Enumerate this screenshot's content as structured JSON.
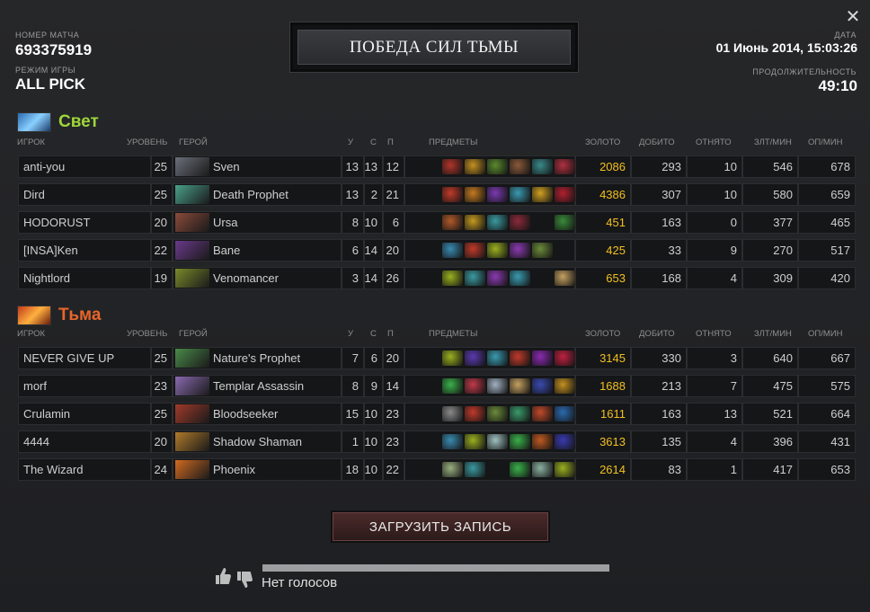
{
  "match": {
    "id_label": "НОМЕР МАТЧА",
    "id": "693375919",
    "mode_label": "РЕЖИМ ИГРЫ",
    "mode": "ALL PICK",
    "result": "ПОБЕДА СИЛ ТЬМЫ",
    "date_label": "ДАТА",
    "date": "01 Июнь 2014, 15:03:26",
    "duration_label": "ПРОДОЛЖИТЕЛЬНОСТЬ",
    "duration": "49:10"
  },
  "columns": {
    "player": "ИГРОК",
    "level": "УРОВЕНЬ",
    "hero": "ГЕРОЙ",
    "kills": "У",
    "deaths": "С",
    "assists": "П",
    "items": "ПРЕДМЕТЫ",
    "gold": "ЗОЛОТО",
    "last_hits": "ДОБИТО",
    "denies": "ОТНЯТО",
    "gpm": "ЗЛТ/МИН",
    "xpm": "ОП/МИН"
  },
  "teams": [
    {
      "name": "Свет",
      "color": "#9fd63a",
      "players": [
        {
          "player": "anti-you",
          "level": "25",
          "hero": "Sven",
          "k": "13",
          "d": "13",
          "a": "12",
          "gold": "2086",
          "lh": "293",
          "dn": "10",
          "gpm": "546",
          "xpm": "678",
          "hero_color": "#6b6f7a",
          "items": [
            "#b0352b",
            "#c49020",
            "#5a8a2e",
            "#8a5a3a",
            "#3a8a8a",
            "#b03040"
          ]
        },
        {
          "player": "Dird",
          "level": "25",
          "hero": "Death Prophet",
          "k": "13",
          "d": "2",
          "a": "21",
          "gold": "4386",
          "lh": "307",
          "dn": "10",
          "gpm": "580",
          "xpm": "659",
          "hero_color": "#4aa08a",
          "items": [
            "#c03a2a",
            "#c47a20",
            "#7a3ab0",
            "#3a9ab0",
            "#d0a020",
            "#b02030"
          ]
        },
        {
          "player": "HODORUST",
          "level": "20",
          "hero": "Ursa",
          "k": "8",
          "d": "10",
          "a": "6",
          "gold": "451",
          "lh": "163",
          "dn": "0",
          "gpm": "377",
          "xpm": "465",
          "hero_color": "#8a4a3a",
          "items": [
            "#b05a2a",
            "#c49a20",
            "#3a9aa0",
            "#8a2a3a",
            "",
            "#3a8a3a"
          ]
        },
        {
          "player": "[INSA]Ken",
          "level": "22",
          "hero": "Bane",
          "k": "6",
          "d": "14",
          "a": "20",
          "gold": "425",
          "lh": "33",
          "dn": "9",
          "gpm": "270",
          "xpm": "517",
          "hero_color": "#6a3a8a",
          "items": [
            "#3a8ab0",
            "#c03a2a",
            "#9ab020",
            "#8a3ab0",
            "#6a8a3a",
            ""
          ]
        },
        {
          "player": "Nightlord",
          "level": "19",
          "hero": "Venomancer",
          "k": "3",
          "d": "14",
          "a": "26",
          "gold": "653",
          "lh": "168",
          "dn": "4",
          "gpm": "309",
          "xpm": "420",
          "hero_color": "#7a8a2a",
          "items": [
            "#9ab020",
            "#3a9aa0",
            "#8a3ab0",
            "#3a9ab0",
            "",
            "#c4a060"
          ]
        }
      ]
    },
    {
      "name": "Тьма",
      "color": "#e8662a",
      "players": [
        {
          "player": "NEVER GIVE UP",
          "level": "25",
          "hero": "Nature's Prophet",
          "k": "7",
          "d": "6",
          "a": "20",
          "gold": "3145",
          "lh": "330",
          "dn": "3",
          "gpm": "640",
          "xpm": "667",
          "hero_color": "#4a8a4a",
          "items": [
            "#9ab020",
            "#5a3ab0",
            "#3a9ab0",
            "#c03a2a",
            "#8a2ab0",
            "#c02040"
          ]
        },
        {
          "player": "morf",
          "level": "23",
          "hero": "Templar Assassin",
          "k": "8",
          "d": "9",
          "a": "14",
          "gold": "1688",
          "lh": "213",
          "dn": "7",
          "gpm": "475",
          "xpm": "575",
          "hero_color": "#8a6ab0",
          "items": [
            "#3ab04a",
            "#c03a4a",
            "#a0b0c0",
            "#c4a060",
            "#3a4ab0",
            "#c49020"
          ]
        },
        {
          "player": "Crulamin",
          "level": "25",
          "hero": "Bloodseeker",
          "k": "15",
          "d": "10",
          "a": "23",
          "gold": "1611",
          "lh": "163",
          "dn": "13",
          "gpm": "521",
          "xpm": "664",
          "hero_color": "#a03a2a",
          "items": [
            "#8a8a8a",
            "#c03a2a",
            "#6a8a3a",
            "#3a9a6a",
            "#c04a2a",
            "#2a6ab0"
          ]
        },
        {
          "player": "4444",
          "level": "20",
          "hero": "Shadow Shaman",
          "k": "1",
          "d": "10",
          "a": "23",
          "gold": "3613",
          "lh": "135",
          "dn": "4",
          "gpm": "396",
          "xpm": "431",
          "hero_color": "#b07a2a",
          "items": [
            "#3a8ab0",
            "#9ab020",
            "#a0c0c0",
            "#3ab04a",
            "#c05a20",
            "#3a3ab0"
          ]
        },
        {
          "player": "The Wizard",
          "level": "24",
          "hero": "Phoenix",
          "k": "18",
          "d": "10",
          "a": "22",
          "gold": "2614",
          "lh": "83",
          "dn": "1",
          "gpm": "417",
          "xpm": "653",
          "hero_color": "#d06a20",
          "items": [
            "#9ab080",
            "#3a9aa0",
            "",
            "#3ab04a",
            "#8ab0a0",
            "#9ab020"
          ]
        }
      ]
    }
  ],
  "download_button": "ЗАГРУЗИТЬ ЗАПИСЬ",
  "votes": {
    "text": "Нет голосов"
  }
}
